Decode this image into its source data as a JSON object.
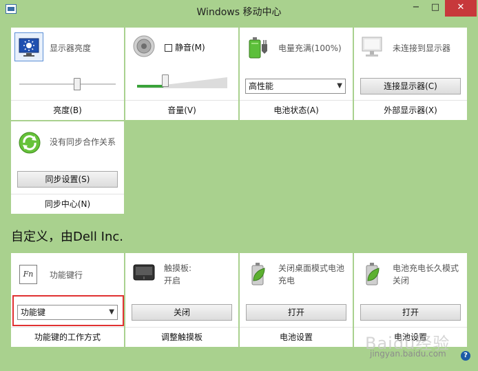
{
  "window": {
    "title": "Windows 移动中心",
    "minimize": "−",
    "maximize": "□",
    "close": "✕"
  },
  "tiles": {
    "brightness": {
      "title": "显示器亮度",
      "label": "亮度(B)",
      "level_fraction": 0.6
    },
    "volume": {
      "checkbox_label": "静音(M)",
      "label": "音量(V)",
      "level_fraction": 0.32
    },
    "battery": {
      "status": "电量充满(100%)",
      "plan_selected": "高性能",
      "label": "电池状态(A)"
    },
    "external_display": {
      "status": "未连接到显示器",
      "button": "连接显示器(C)",
      "label": "外部显示器(X)"
    },
    "sync": {
      "status": "没有同步合作关系",
      "button": "同步设置(S)",
      "label": "同步中心(N)"
    },
    "fn_keys": {
      "title": "功能键行",
      "selected": "功能键",
      "label": "功能键的工作方式",
      "icon_text": "Fn"
    },
    "touchpad": {
      "title_line1": "触摸板:",
      "title_line2": "开启",
      "button": "关闭",
      "label": "调整触摸板"
    },
    "battery_settings": {
      "title_line1": "关闭桌面模式电池",
      "title_line2": "充电",
      "button": "打开",
      "label": "电池设置"
    },
    "battery_long_life": {
      "title_line1": "电池充电长久模式",
      "title_line2": "关闭",
      "button": "打开",
      "label": "电池设置"
    }
  },
  "section_heading": "自定义，由Dell Inc.",
  "help_glyph": "?",
  "watermark": {
    "text": "Baidu经验",
    "url": "jingyan.baidu.com"
  },
  "colors": {
    "background": "#a9d18e",
    "highlight_border": "#e03131",
    "close_button": "#c7383b"
  }
}
